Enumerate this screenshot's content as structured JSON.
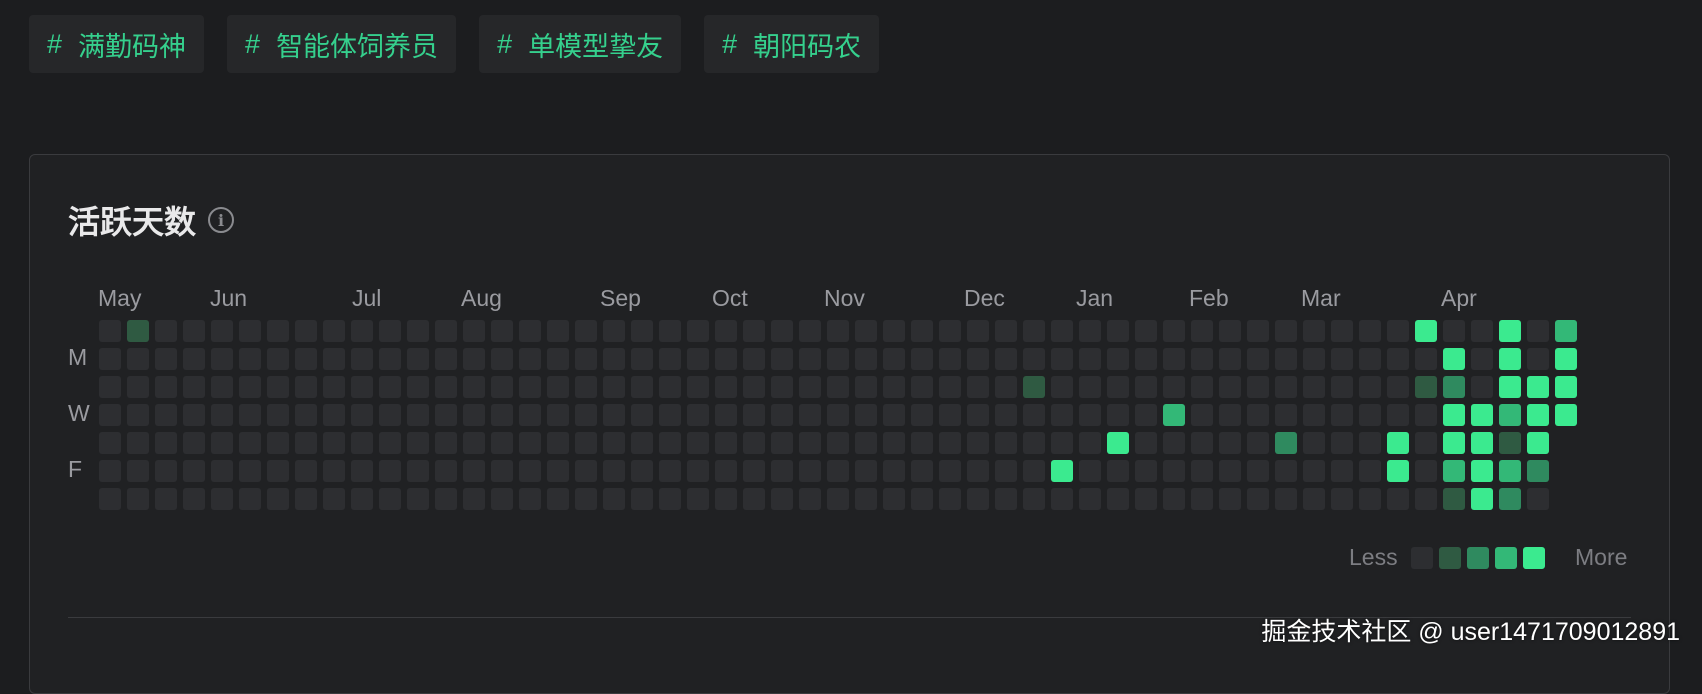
{
  "tags": [
    {
      "hash": "#",
      "label": "满勤码神"
    },
    {
      "hash": "#",
      "label": "智能体饲养员"
    },
    {
      "hash": "#",
      "label": "单模型挚友"
    },
    {
      "hash": "#",
      "label": "朝阳码农"
    }
  ],
  "panel": {
    "title": "活跃天数",
    "info_icon": "info-icon",
    "months": [
      "May",
      "Jun",
      "Jul",
      "Aug",
      "Sep",
      "Oct",
      "Nov",
      "Dec",
      "Jan",
      "Feb",
      "Mar",
      "Apr"
    ],
    "day_labels": [
      "M",
      "W",
      "F"
    ],
    "legend": {
      "less": "Less",
      "more": "More"
    }
  },
  "colors": {
    "level0": "#2d2e31",
    "level1": "#2f5a42",
    "level2": "#2f8a5f",
    "level3": "#33b877",
    "level4": "#3bea8f"
  },
  "chart_data": {
    "type": "heatmap",
    "weeks": 53,
    "days_per_week": 7,
    "levels": {
      "2": [
        [
          0,
          1
        ]
      ],
      "34": [
        [
          2,
          1
        ]
      ],
      "35": [
        [
          5,
          4
        ]
      ],
      "37": [
        [
          4,
          4
        ]
      ],
      "39": [
        [
          3,
          3
        ]
      ],
      "43": [
        [
          4,
          2
        ]
      ],
      "47": [
        [
          4,
          4
        ],
        [
          5,
          4
        ]
      ],
      "48": [
        [
          0,
          4
        ],
        [
          2,
          1
        ]
      ],
      "49": [
        [
          1,
          4
        ],
        [
          2,
          2
        ],
        [
          3,
          4
        ],
        [
          4,
          4
        ],
        [
          5,
          3
        ],
        [
          6,
          1
        ]
      ],
      "50": [
        [
          3,
          4
        ],
        [
          4,
          4
        ],
        [
          5,
          4
        ],
        [
          6,
          4
        ]
      ],
      "51": [
        [
          0,
          4
        ],
        [
          1,
          4
        ],
        [
          2,
          4
        ],
        [
          3,
          3
        ],
        [
          4,
          1
        ],
        [
          5,
          3
        ],
        [
          6,
          2
        ]
      ],
      "52": [
        [
          2,
          4
        ],
        [
          3,
          4
        ],
        [
          4,
          4
        ],
        [
          5,
          2
        ]
      ],
      "53": [
        [
          0,
          3
        ],
        [
          1,
          4
        ],
        [
          2,
          4
        ],
        [
          3,
          4
        ]
      ]
    }
  },
  "watermark": "掘金技术社区 @ user1471709012891"
}
